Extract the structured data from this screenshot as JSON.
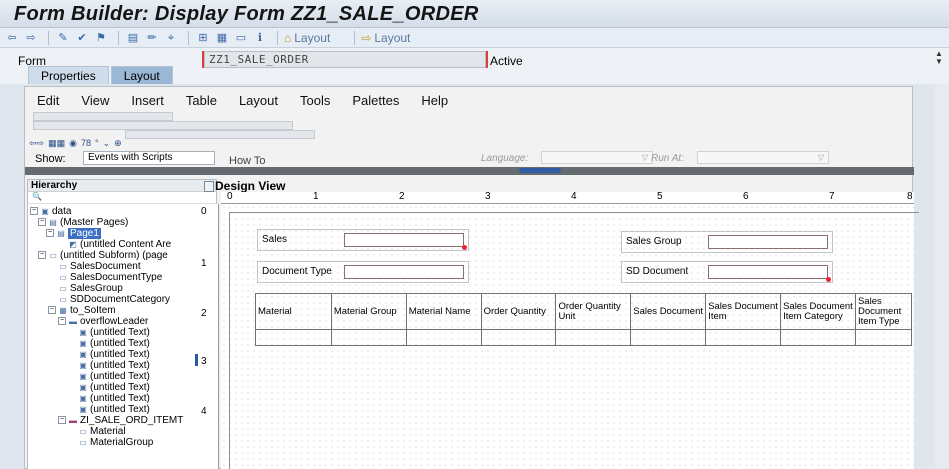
{
  "window": {
    "title": "Form Builder: Display Form ZZ1_SALE_ORDER"
  },
  "toolbar": {
    "layout_label_1": "Layout",
    "layout_label_2": "Layout"
  },
  "form": {
    "label": "Form",
    "name": "ZZ1_SALE_ORDER",
    "status": "Active",
    "tabs": [
      {
        "label": "Properties"
      },
      {
        "label": "Layout"
      }
    ]
  },
  "designer": {
    "menu": [
      "Edit",
      "View",
      "Insert",
      "Table",
      "Layout",
      "Tools",
      "Palettes",
      "Help"
    ],
    "zoom": "78",
    "show_label": "Show:",
    "show_value": "Events with Scripts",
    "howto": "How To",
    "language_label": "Language:",
    "run_at_label": "Run At:"
  },
  "hierarchy": {
    "title": "Hierarchy",
    "nodes": [
      {
        "label": "data"
      },
      {
        "label": "(Master Pages)"
      },
      {
        "label": "Page1"
      },
      {
        "label": "(untitled Content Are"
      },
      {
        "label": "(untitled Subform) (page"
      },
      {
        "label": "SalesDocument"
      },
      {
        "label": "SalesDocumentType"
      },
      {
        "label": "SalesGroup"
      },
      {
        "label": "SDDocumentCategory"
      },
      {
        "label": "to_SoItem"
      },
      {
        "label": "overflowLeader"
      },
      {
        "label": "(untitled Text)"
      },
      {
        "label": "(untitled Text)"
      },
      {
        "label": "(untitled Text)"
      },
      {
        "label": "(untitled Text)"
      },
      {
        "label": "(untitled Text)"
      },
      {
        "label": "(untitled Text)"
      },
      {
        "label": "(untitled Text)"
      },
      {
        "label": "(untitled Text)"
      },
      {
        "label": "ZI_SALE_ORD_ITEMT"
      },
      {
        "label": "Material"
      },
      {
        "label": "MaterialGroup"
      }
    ]
  },
  "design_view": {
    "title": "Design View",
    "ruler_top": [
      "0",
      "1",
      "2",
      "3",
      "4",
      "5",
      "6",
      "7",
      "8"
    ],
    "ruler_left": [
      "0",
      "1",
      "2",
      "3",
      "4"
    ],
    "fields": [
      {
        "label": "Sales"
      },
      {
        "label": "Document Type"
      },
      {
        "label": "Sales Group"
      },
      {
        "label": "SD Document"
      }
    ],
    "columns": [
      "Material",
      "Material Group",
      "Material Name",
      "Order Quantity",
      "Order Quantity Unit",
      "Sales Document",
      "Sales Document Item",
      "Sales Document Item Category",
      "Sales Document Item Type"
    ]
  }
}
